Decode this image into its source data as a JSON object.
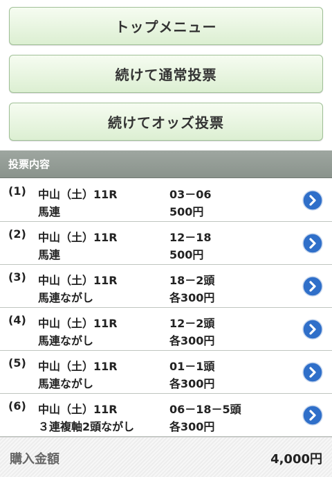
{
  "buttons": {
    "top_menu": "トップメニュー",
    "continue_normal": "続けて通常投票",
    "continue_odds": "続けてオッズ投票"
  },
  "section": {
    "title": "投票内容"
  },
  "bets": [
    {
      "index": "(1)",
      "race": "中山（土）11R",
      "type": "馬連",
      "combo": "03－06",
      "amount": "500円"
    },
    {
      "index": "(2)",
      "race": "中山（土）11R",
      "type": "馬連",
      "combo": "12－18",
      "amount": "500円"
    },
    {
      "index": "(3)",
      "race": "中山（土）11R",
      "type": "馬連ながし",
      "combo": "18－2頭",
      "amount": "各300円"
    },
    {
      "index": "(4)",
      "race": "中山（土）11R",
      "type": "馬連ながし",
      "combo": "12－2頭",
      "amount": "各300円"
    },
    {
      "index": "(5)",
      "race": "中山（土）11R",
      "type": "馬連ながし",
      "combo": "01－1頭",
      "amount": "各300円"
    },
    {
      "index": "(6)",
      "race": "中山（土）11R",
      "type": "３連複軸2頭ながし",
      "combo": "06－18－5頭",
      "amount": "各300円"
    }
  ],
  "total": {
    "label": "購入金額",
    "value": "4,000円"
  },
  "colors": {
    "button_bg": "#e6f4de",
    "header_bg": "#959d97",
    "arrow_blue": "#2f6fc9"
  }
}
